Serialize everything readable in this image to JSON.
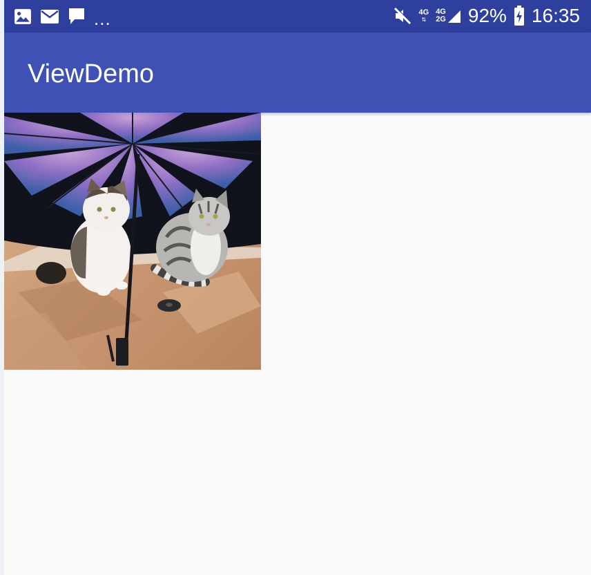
{
  "status_bar": {
    "notification_icons": [
      "image-icon",
      "mail-icon",
      "message-icon"
    ],
    "overflow_text": "...",
    "mute_icon": "mute-icon",
    "network_primary": "4G",
    "network_secondary_top": "4G",
    "network_secondary_bottom": "2G",
    "battery_percent": "92%",
    "battery_icon": "battery-charging-icon",
    "time": "16:35",
    "background_color": "#2f3f9e"
  },
  "app_bar": {
    "title": "ViewDemo",
    "background_color": "#3f51b5"
  },
  "content": {
    "image_view": "cats-under-umbrella-photo",
    "background_color": "#fafafa"
  }
}
